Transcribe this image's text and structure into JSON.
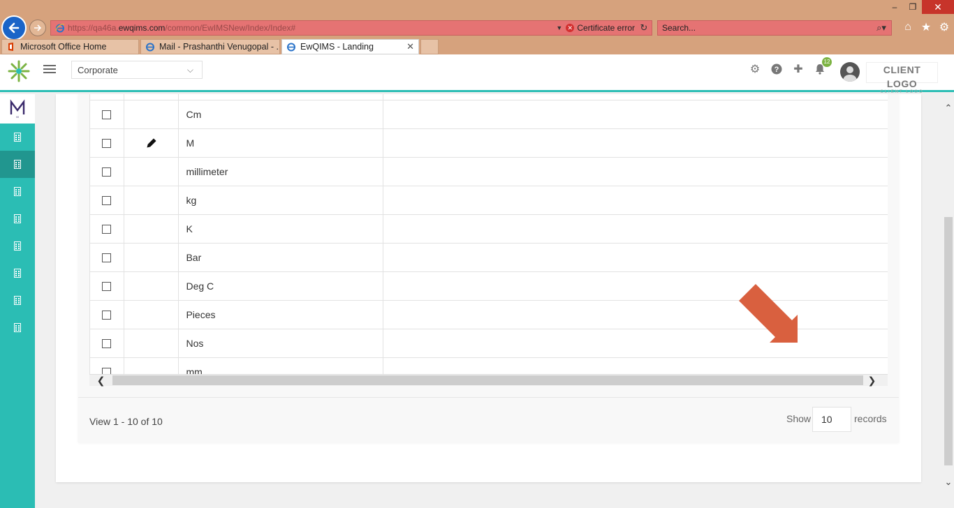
{
  "browser": {
    "url_prefix": "https://qa46a.",
    "url_domain": "ewqims.com",
    "url_path": "/common/EwIMSNew/Index/Index#",
    "cert_error": "Certificate error",
    "search_placeholder": "Search...",
    "tabs": [
      {
        "label": "Microsoft Office Home"
      },
      {
        "label": "Mail - Prashanthi Venugopal - ..."
      },
      {
        "label": "EwQIMS - Landing"
      }
    ]
  },
  "header": {
    "company": "Corporate",
    "notification_count": "12",
    "client_logo": "CLIENT LOGO",
    "client_logo_sub": "CLIENT LOGO"
  },
  "sidebar": {
    "logo_letter": "M",
    "items": [
      "building-1",
      "building-2",
      "building-3",
      "building-4",
      "building-5",
      "building-6",
      "building-7",
      "building-8"
    ],
    "active_index": 1
  },
  "table": {
    "rows": [
      {
        "name": "",
        "editing": false
      },
      {
        "name": "Cm",
        "editing": false
      },
      {
        "name": "M",
        "editing": true
      },
      {
        "name": "millimeter",
        "editing": false
      },
      {
        "name": "kg",
        "editing": false
      },
      {
        "name": "K",
        "editing": false
      },
      {
        "name": "Bar",
        "editing": false
      },
      {
        "name": "Deg C",
        "editing": false
      },
      {
        "name": "Pieces",
        "editing": false
      },
      {
        "name": "Nos",
        "editing": false
      },
      {
        "name": "mm",
        "editing": false
      }
    ]
  },
  "pager": {
    "view_info": "View 1 - 10 of 10",
    "show_label": "Show",
    "page_size": "10",
    "records_label": "records"
  },
  "colors": {
    "accent": "#2bbdb4",
    "sidebar_active": "#21968f",
    "annotation_arrow": "#d9603f",
    "address_bar": "#e57373",
    "chrome": "#d6a27d"
  }
}
